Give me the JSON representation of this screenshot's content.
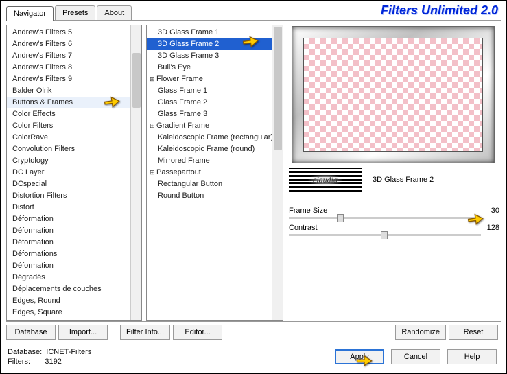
{
  "branding": "Filters Unlimited 2.0",
  "tabs": {
    "navigator": "Navigator",
    "presets": "Presets",
    "about": "About"
  },
  "list1": {
    "items": [
      "Andrew's Filters 5",
      "Andrew's Filters 6",
      "Andrew's Filters 7",
      "Andrew's Filters 8",
      "Andrew's Filters 9",
      "Balder Olrik",
      "Buttons & Frames",
      "Color Effects",
      "Color Filters",
      "ColorRave",
      "Convolution Filters",
      "Cryptology",
      "DC Layer",
      "DCspecial",
      "Distortion Filters",
      "Distort",
      "Déformation",
      "Déformation",
      "Déformation",
      "Déformations",
      "Déformation",
      "Dégradés",
      "Déplacements de couches",
      "Edges, Round",
      "Edges, Square"
    ],
    "selected_index": 6
  },
  "list2": {
    "items": [
      {
        "label": "3D Glass Frame 1",
        "exp": false,
        "sel": false
      },
      {
        "label": "3D Glass Frame 2",
        "exp": false,
        "sel": true
      },
      {
        "label": "3D Glass Frame 3",
        "exp": false,
        "sel": false
      },
      {
        "label": "Bull's Eye",
        "exp": false,
        "sel": false
      },
      {
        "label": "Flower Frame",
        "exp": true,
        "sel": false
      },
      {
        "label": "Glass Frame 1",
        "exp": false,
        "sel": false
      },
      {
        "label": "Glass Frame 2",
        "exp": false,
        "sel": false
      },
      {
        "label": "Glass Frame 3",
        "exp": false,
        "sel": false
      },
      {
        "label": "Gradient Frame",
        "exp": true,
        "sel": false
      },
      {
        "label": "Kaleidoscopic Frame (rectangular)",
        "exp": false,
        "sel": false
      },
      {
        "label": "Kaleidoscopic Frame (round)",
        "exp": false,
        "sel": false
      },
      {
        "label": "Mirrored Frame",
        "exp": false,
        "sel": false
      },
      {
        "label": "Passepartout",
        "exp": true,
        "sel": false
      },
      {
        "label": "Rectangular Button",
        "exp": false,
        "sel": false
      },
      {
        "label": "Round Button",
        "exp": false,
        "sel": false
      }
    ]
  },
  "watermark": "claudia",
  "selected_filter_name": "3D Glass Frame 2",
  "params": {
    "frame_size": {
      "label": "Frame Size",
      "value": "30"
    },
    "contrast": {
      "label": "Contrast",
      "value": "128"
    }
  },
  "buttons": {
    "database": "Database",
    "import": "Import...",
    "filter_info": "Filter Info...",
    "editor": "Editor...",
    "randomize": "Randomize",
    "reset": "Reset",
    "apply": "Apply",
    "cancel": "Cancel",
    "help": "Help"
  },
  "footer": {
    "db_label": "Database:",
    "db_value": "ICNET-Filters",
    "filters_label": "Filters:",
    "filters_value": "3192"
  }
}
